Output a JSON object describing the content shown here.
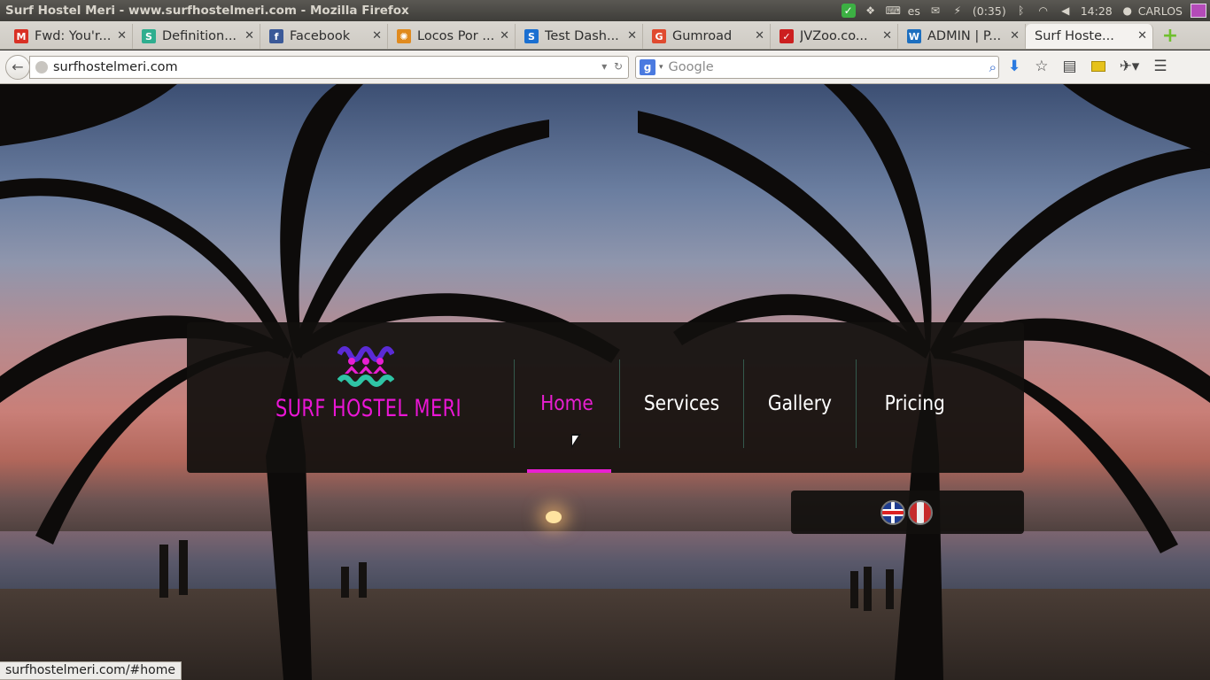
{
  "os": {
    "window_title": "Surf Hostel Meri - www.surfhostelmeri.com - Mozilla Firefox",
    "keyboard": "es",
    "battery": "(0:35)",
    "time": "14:28",
    "user": "CARLOS"
  },
  "tabs": [
    {
      "label": "Fwd: You'r...",
      "favicon": "gmail-icon",
      "favicon_text": "M",
      "color": "#d93025"
    },
    {
      "label": "Definition...",
      "favicon": "s-icon",
      "favicon_text": "S",
      "color": "#2fae8f"
    },
    {
      "label": "Facebook",
      "favicon": "facebook-icon",
      "favicon_text": "f",
      "color": "#3b5998"
    },
    {
      "label": "Locos Por ...",
      "favicon": "gear-icon",
      "favicon_text": "✺",
      "color": "#e08a1e"
    },
    {
      "label": "Test Dash...",
      "favicon": "s-icon",
      "favicon_text": "S",
      "color": "#1a6fd1"
    },
    {
      "label": "Gumroad",
      "favicon": "gumroad-icon",
      "favicon_text": "G",
      "color": "#e04a2f"
    },
    {
      "label": "JVZoo.co...",
      "favicon": "jvzoo-icon",
      "favicon_text": "✓",
      "color": "#cc1f1f"
    },
    {
      "label": "ADMIN | P...",
      "favicon": "w-icon",
      "favicon_text": "W",
      "color": "#1d6fbf"
    },
    {
      "label": "Surf Hoste...",
      "favicon": "none",
      "favicon_text": "",
      "color": "#f4f2ef"
    }
  ],
  "navbar": {
    "url": "surfhostelmeri.com",
    "search_placeholder": "Google"
  },
  "site": {
    "title": "SURF HOSTEL MERI",
    "menu": [
      {
        "label": "Home",
        "active": true
      },
      {
        "label": "Services",
        "active": false
      },
      {
        "label": "Gallery",
        "active": false
      },
      {
        "label": "Pricing",
        "active": false
      }
    ],
    "accent_color": "#e81fd2",
    "languages": [
      "uk-flag-icon",
      "peru-flag-icon"
    ]
  },
  "status_bar": "surfhostelmeri.com/#home"
}
